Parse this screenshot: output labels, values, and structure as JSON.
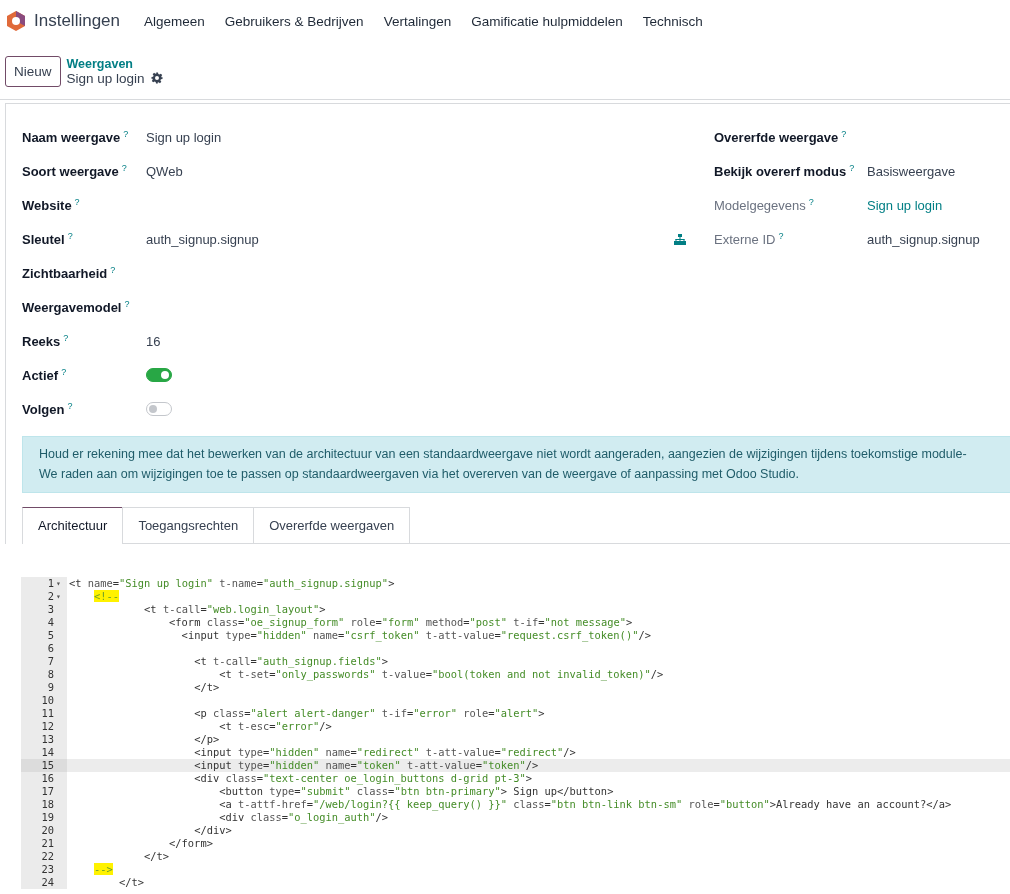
{
  "navbar": {
    "app": "Instellingen",
    "menu": [
      "Algemeen",
      "Gebruikers & Bedrijven",
      "Vertalingen",
      "Gamificatie hulpmiddelen",
      "Technisch"
    ]
  },
  "control_panel": {
    "new_button": "Nieuw",
    "breadcrumb": "Weergaven",
    "record": "Sign up login"
  },
  "form": {
    "left": [
      {
        "label": "Naam weergave",
        "help": "?",
        "kind": "text",
        "value": "Sign up login",
        "readonly": false
      },
      {
        "label": "Soort weergave",
        "help": "?",
        "kind": "text",
        "value": "QWeb",
        "readonly": false
      },
      {
        "label": "Website",
        "help": "?",
        "kind": "empty",
        "readonly": false
      },
      {
        "label": "Sleutel",
        "help": "?",
        "kind": "key",
        "value": "auth_signup.signup",
        "readonly": false
      },
      {
        "label": "Zichtbaarheid",
        "help": "?",
        "kind": "empty",
        "readonly": false
      },
      {
        "label": "Weergavemodel",
        "help": "?",
        "kind": "empty",
        "readonly": false
      },
      {
        "label": "Reeks",
        "help": "?",
        "kind": "text",
        "value": "16",
        "readonly": false
      },
      {
        "label": "Actief",
        "help": "?",
        "kind": "toggle",
        "on": true,
        "readonly": false
      },
      {
        "label": "Volgen",
        "help": "?",
        "kind": "toggle",
        "on": false,
        "readonly": false
      }
    ],
    "right": [
      {
        "label": "Overerfde weergave",
        "help": "?",
        "kind": "empty",
        "readonly": false
      },
      {
        "label": "Bekijk overerf modus",
        "help": "?",
        "kind": "text",
        "value": "Basisweergave",
        "readonly": false
      },
      {
        "label": "Modelgegevens",
        "help": "?",
        "kind": "link",
        "value": "Sign up login",
        "readonly": true
      },
      {
        "label": "Externe ID",
        "help": "?",
        "kind": "text",
        "value": "auth_signup.signup",
        "readonly": true
      }
    ]
  },
  "alert": [
    "Houd er rekening mee dat het bewerken van de architectuur van een standaardweergave niet wordt aangeraden, aangezien de wijzigingen tijdens toekomstige module-",
    "We raden aan om wijzigingen toe te passen op standaardweergaven via het overerven van de weergave of aanpassing met Odoo Studio."
  ],
  "tabs": [
    {
      "label": "Architectuur",
      "selected": true
    },
    {
      "label": "Toegangsrechten",
      "selected": false
    },
    {
      "label": "Overerfde weergaven",
      "selected": false
    }
  ],
  "code": [
    {
      "number": "1",
      "fold": "▾",
      "text": "<t name=\"Sign up login\" t-name=\"auth_signup.signup\">",
      "kind": "code",
      "highlighted": false,
      "active": false
    },
    {
      "number": "2",
      "fold": "▾",
      "text": "    <!--",
      "kind": "comment",
      "highlighted": true,
      "active": false
    },
    {
      "number": "3",
      "text": "            <t t-call=\"web.login_layout\">",
      "kind": "code",
      "highlighted": false,
      "active": false
    },
    {
      "number": "4",
      "text": "                <form class=\"oe_signup_form\" role=\"form\" method=\"post\" t-if=\"not message\">",
      "kind": "code",
      "highlighted": false,
      "active": false
    },
    {
      "number": "5",
      "text": "                  <input type=\"hidden\" name=\"csrf_token\" t-att-value=\"request.csrf_token()\"/>",
      "kind": "code",
      "highlighted": false,
      "active": false
    },
    {
      "number": "6",
      "active": false
    },
    {
      "number": "7",
      "text": "                    <t t-call=\"auth_signup.fields\">",
      "kind": "code",
      "highlighted": false,
      "active": false
    },
    {
      "number": "8",
      "text": "                        <t t-set=\"only_passwords\" t-value=\"bool(token and not invalid_token)\"/>",
      "kind": "code",
      "highlighted": false,
      "active": false
    },
    {
      "number": "9",
      "text": "                    </t>",
      "kind": "code",
      "highlighted": false,
      "active": false
    },
    {
      "number": "10",
      "active": false
    },
    {
      "number": "11",
      "text": "                    <p class=\"alert alert-danger\" t-if=\"error\" role=\"alert\">",
      "kind": "code",
      "highlighted": false,
      "active": false
    },
    {
      "number": "12",
      "text": "                        <t t-esc=\"error\"/>",
      "kind": "code",
      "highlighted": false,
      "active": false
    },
    {
      "number": "13",
      "text": "                    </p>",
      "kind": "code",
      "highlighted": false,
      "active": false
    },
    {
      "number": "14",
      "text": "                    <input type=\"hidden\" name=\"redirect\" t-att-value=\"redirect\"/>",
      "kind": "code",
      "highlighted": false,
      "active": false
    },
    {
      "number": "15",
      "text": "                    <input type=\"hidden\" name=\"token\" t-att-value=\"token\"/>",
      "kind": "code",
      "highlighted": false,
      "active": true
    },
    {
      "number": "16",
      "text": "                    <div class=\"text-center oe_login_buttons d-grid pt-3\">",
      "kind": "code",
      "highlighted": false,
      "active": false
    },
    {
      "number": "17",
      "text": "                        <button type=\"submit\" class=\"btn btn-primary\"> Sign up</button>",
      "kind": "code",
      "highlighted": false,
      "active": false
    },
    {
      "number": "18",
      "text": "                        <a t-attf-href=\"/web/login?{{ keep_query() }}\" class=\"btn btn-link btn-sm\" role=\"button\">Already have an account?</a>",
      "kind": "code",
      "highlighted": false,
      "active": false
    },
    {
      "number": "19",
      "text": "                        <div class=\"o_login_auth\"/>",
      "kind": "code",
      "highlighted": false,
      "active": false
    },
    {
      "number": "20",
      "text": "                    </div>",
      "kind": "code",
      "highlighted": false,
      "active": false
    },
    {
      "number": "21",
      "text": "                </form>",
      "kind": "code",
      "highlighted": false,
      "active": false
    },
    {
      "number": "22",
      "text": "            </t>",
      "kind": "code",
      "highlighted": false,
      "active": false
    },
    {
      "number": "23",
      "text": "    -->",
      "kind": "comment",
      "highlighted": true,
      "active": false
    },
    {
      "number": "24",
      "text": "        </t>",
      "kind": "code",
      "highlighted": false,
      "active": false
    }
  ]
}
